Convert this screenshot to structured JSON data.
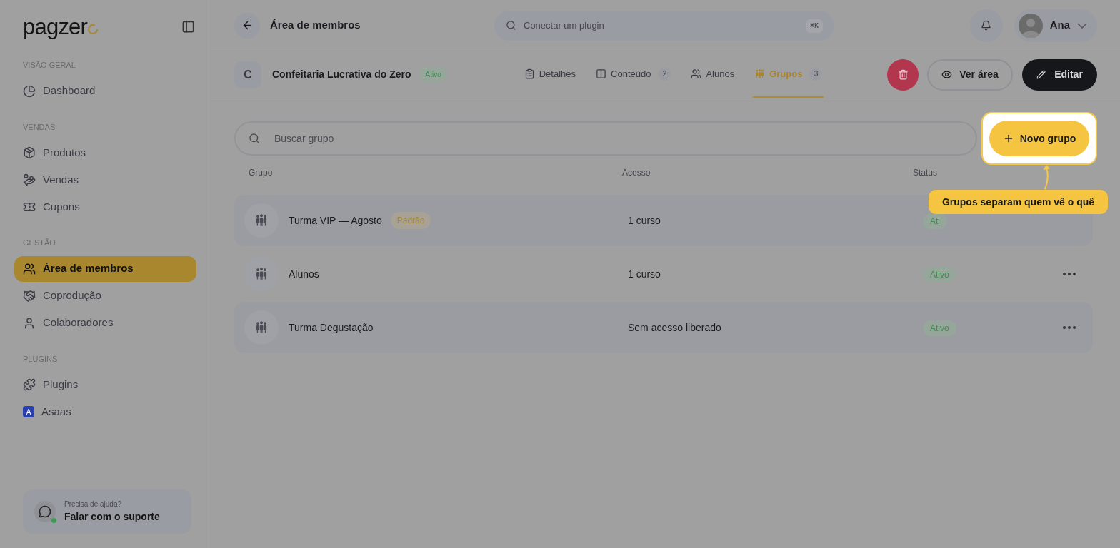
{
  "logo": {
    "text": "pagzer"
  },
  "sidebar": {
    "sections": [
      {
        "title": "VISÃO GERAL",
        "items": [
          {
            "label": "Dashboard",
            "kind": "chart",
            "selected": false
          }
        ]
      },
      {
        "title": "VENDAS",
        "items": [
          {
            "label": "Produtos",
            "kind": "package",
            "selected": false
          },
          {
            "label": "Vendas",
            "kind": "coins",
            "selected": false
          },
          {
            "label": "Cupons",
            "kind": "ticket",
            "selected": false
          }
        ]
      },
      {
        "title": "GESTÃO",
        "items": [
          {
            "label": "Área de membros",
            "kind": "users",
            "selected": true
          },
          {
            "label": "Coprodução",
            "kind": "handshake",
            "selected": false
          },
          {
            "label": "Colaboradores",
            "kind": "user",
            "selected": false
          }
        ]
      },
      {
        "title": "PLUGINS",
        "items": [
          {
            "label": "Plugins",
            "kind": "puzzle",
            "selected": false
          },
          {
            "label": "Asaas",
            "kind": "app",
            "glyph": "A",
            "selected": false
          }
        ]
      }
    ]
  },
  "help": {
    "question": "Precisa de ajuda?",
    "action": "Falar com o suporte"
  },
  "header": {
    "title": "Área de membros",
    "search_placeholder": "Conectar um plugin",
    "shortcut": "⌘K",
    "user": "Ana"
  },
  "course": {
    "initial": "C",
    "name": "Confeitaria Lucrativa do Zero",
    "status": "Ativo"
  },
  "tabs": [
    {
      "label": "Detalhes",
      "kind": "clipboard",
      "selected": false
    },
    {
      "label": "Conteúdo",
      "kind": "columns",
      "count": "2",
      "selected": false
    },
    {
      "label": "Alunos",
      "kind": "users",
      "selected": false
    },
    {
      "label": "Grupos",
      "kind": "group",
      "count": "3",
      "selected": true
    }
  ],
  "actions": {
    "view": "Ver área",
    "edit": "Editar"
  },
  "group_search": {
    "placeholder": "Buscar grupo"
  },
  "new_button": "Novo grupo",
  "columns": [
    "Grupo",
    "Acesso",
    "Status"
  ],
  "rows": [
    {
      "name": "Turma VIP — Agosto",
      "badge": "Padrão",
      "access": "1 curso",
      "status": "Ati",
      "menu": false
    },
    {
      "name": "Alunos",
      "access": "1 curso",
      "status": "Ativo",
      "menu": true
    },
    {
      "name": "Turma Degustação",
      "access": "Sem acesso liberado",
      "status": "Ativo",
      "menu": true
    }
  ],
  "tooltip": "Grupos separam quem vê o quê"
}
